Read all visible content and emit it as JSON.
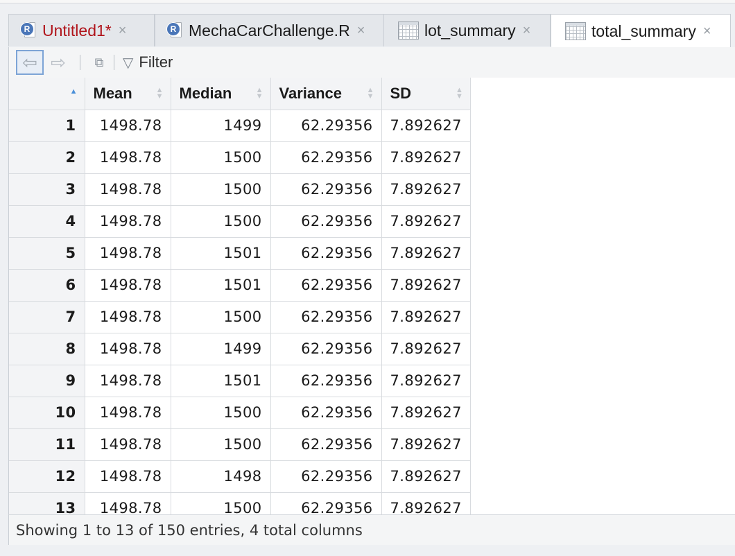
{
  "tabs": [
    {
      "label": "Untitled1*",
      "kind": "r-script",
      "modified": true
    },
    {
      "label": "MechaCarChallenge.R",
      "kind": "r-script",
      "modified": false
    },
    {
      "label": "lot_summary",
      "kind": "data-view",
      "modified": false
    },
    {
      "label": "total_summary",
      "kind": "data-view",
      "modified": false,
      "active": true
    }
  ],
  "close_glyph": "×",
  "toolbar": {
    "back_icon": "back-arrow-icon",
    "forward_icon": "forward-arrow-icon",
    "popout_icon": "popout-window-icon",
    "filter_label": "Filter"
  },
  "table": {
    "columns": [
      "Mean",
      "Median",
      "Variance",
      "SD"
    ],
    "rows": [
      {
        "n": "1",
        "mean": "1498.78",
        "median": "1499",
        "variance": "62.29356",
        "sd": "7.892627"
      },
      {
        "n": "2",
        "mean": "1498.78",
        "median": "1500",
        "variance": "62.29356",
        "sd": "7.892627"
      },
      {
        "n": "3",
        "mean": "1498.78",
        "median": "1500",
        "variance": "62.29356",
        "sd": "7.892627"
      },
      {
        "n": "4",
        "mean": "1498.78",
        "median": "1500",
        "variance": "62.29356",
        "sd": "7.892627"
      },
      {
        "n": "5",
        "mean": "1498.78",
        "median": "1501",
        "variance": "62.29356",
        "sd": "7.892627"
      },
      {
        "n": "6",
        "mean": "1498.78",
        "median": "1501",
        "variance": "62.29356",
        "sd": "7.892627"
      },
      {
        "n": "7",
        "mean": "1498.78",
        "median": "1500",
        "variance": "62.29356",
        "sd": "7.892627"
      },
      {
        "n": "8",
        "mean": "1498.78",
        "median": "1499",
        "variance": "62.29356",
        "sd": "7.892627"
      },
      {
        "n": "9",
        "mean": "1498.78",
        "median": "1501",
        "variance": "62.29356",
        "sd": "7.892627"
      },
      {
        "n": "10",
        "mean": "1498.78",
        "median": "1500",
        "variance": "62.29356",
        "sd": "7.892627"
      },
      {
        "n": "11",
        "mean": "1498.78",
        "median": "1500",
        "variance": "62.29356",
        "sd": "7.892627"
      },
      {
        "n": "12",
        "mean": "1498.78",
        "median": "1498",
        "variance": "62.29356",
        "sd": "7.892627"
      },
      {
        "n": "13",
        "mean": "1498.78",
        "median": "1500",
        "variance": "62.29356",
        "sd": "7.892627"
      }
    ]
  },
  "status": "Showing 1 to 13 of 150 entries, 4 total columns",
  "colors": {
    "modified_tab_text": "#b0141b",
    "r_badge": "#4a76b8",
    "sort_active": "#4a8fd8"
  }
}
